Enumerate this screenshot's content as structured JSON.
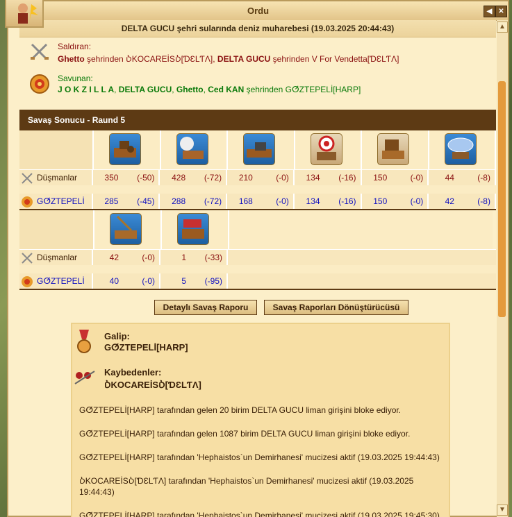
{
  "window": {
    "title": "Ordu",
    "close": "✕",
    "back": "◀"
  },
  "report": {
    "title": "DELTA GUCU şehri sularında deniz muharebesi (19.03.2025 20:44:43)",
    "attacker_role": "Saldıran:",
    "attacker_desc": [
      "Ghetto",
      " şehrinden ",
      "ⳲKOCAREİSⳲ[ƊƐLƬΛ]",
      ", ",
      "DELTA GUCU",
      " şehrinden V For Vendetta[ƊƐLƬΛ]"
    ],
    "defender_role": "Savunan:",
    "defender_desc": [
      "J O K Z I L L A",
      ", ",
      "DELTA GUCU",
      ", ",
      "Ghetto",
      ", ",
      "Ced KAN",
      " şehrinden GⵚZTEPELİ[HARP]"
    ]
  },
  "result": {
    "title": "Savaş Sonucu - Raund 5",
    "enemy_label": "Düşmanlar",
    "ours_label": "GⵚZTEPELİ",
    "block1": {
      "units": [
        "ship-1-icon",
        "ship-2-icon",
        "ship-3-icon",
        "ship-4-icon",
        "ship-5-icon",
        "ship-6-icon"
      ],
      "enemy": [
        [
          "350",
          "(-50)"
        ],
        [
          "428",
          "(-72)"
        ],
        [
          "210",
          "(-0)"
        ],
        [
          "134",
          "(-16)"
        ],
        [
          "150",
          "(-0)"
        ],
        [
          "44",
          "(-8)"
        ]
      ],
      "ours": [
        [
          "285",
          "(-45)"
        ],
        [
          "288",
          "(-72)"
        ],
        [
          "168",
          "(-0)"
        ],
        [
          "134",
          "(-16)"
        ],
        [
          "150",
          "(-0)"
        ],
        [
          "42",
          "(-8)"
        ]
      ]
    },
    "block2": {
      "units": [
        "ship-7-icon",
        "ship-8-icon"
      ],
      "enemy": [
        [
          "42",
          "(-0)"
        ],
        [
          "1",
          "(-33)"
        ]
      ],
      "ours": [
        [
          "40",
          "(-0)"
        ],
        [
          "5",
          "(-95)"
        ]
      ]
    }
  },
  "buttons": {
    "detailed": "Detaylı Savaş Raporu",
    "converter": "Savaş Raporları Dönüştürücüsü"
  },
  "summary": {
    "winner_label": "Galip:",
    "winner": "GⵚZTEPELİ[HARP]",
    "losers_label": "Kaybedenler:",
    "losers": "ⳲKOCAREİSⳲ[ƊƐLƬΛ]",
    "log": [
      "GⵚZTEPELİ[HARP] tarafından gelen 20 birim DELTA GUCU liman girişini bloke ediyor.",
      "GⵚZTEPELİ[HARP] tarafından gelen 1087 birim DELTA GUCU liman girişini bloke ediyor.",
      "GⵚZTEPELİ[HARP] tarafından 'Hephaistos`un Demirhanesi' mucizesi aktif (19.03.2025 19:44:43)",
      "ⳲKOCAREİSⳲ[ƊƐLƬΛ] tarafından 'Hephaistos`un Demirhanesi' mucizesi aktif (19.03.2025 19:44:43)",
      "GⵚZTEPELİ[HARP] tarafından 'Hephaistos`un Demirhanesi' mucizesi aktif (19.03.2025 19:45:30)"
    ]
  },
  "colors": {
    "enemy": "#8a1010",
    "ours": "#1010c0",
    "header_bg": "#5d3a14",
    "green": "#0a7a0a"
  }
}
